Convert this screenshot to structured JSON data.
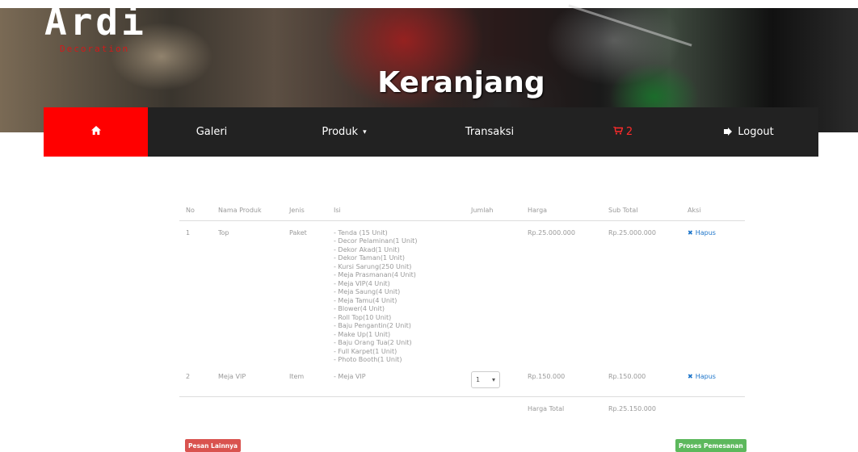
{
  "brand": {
    "logo": "Ardi",
    "logo_sub": "Decoration"
  },
  "header": {
    "title": "Keranjang"
  },
  "nav": {
    "home_icon": "home-icon",
    "galeri": "Galeri",
    "produk": "Produk",
    "produk_caret": "▾",
    "transaksi": "Transaksi",
    "cart_icon": "cart-icon",
    "cart_count": "2",
    "logout_icon": "sign-out-icon",
    "logout": "Logout"
  },
  "table": {
    "headers": [
      "No",
      "Nama Produk",
      "Jenis",
      "Isi",
      "Jumlah",
      "Harga",
      "Sub Total",
      "Aksi"
    ],
    "rows": [
      {
        "no": "1",
        "name": "Top",
        "jenis": "Paket",
        "isi": [
          "- Tenda (15 Unit)",
          "- Decor Pelaminan(1 Unit)",
          "- Dekor Akad(1 Unit)",
          "- Dekor Taman(1 Unit)",
          "- Kursi Sarung(250 Unit)",
          "- Meja Prasmanan(4 Unit)",
          "- Meja VIP(4 Unit)",
          "- Meja Saung(4 Unit)",
          "- Meja Tamu(4 Unit)",
          "- Blower(4 Unit)",
          "- Roll Top(10 Unit)",
          "- Baju Pengantin(2 Unit)",
          "- Make Up(1 Unit)",
          "- Baju Orang Tua(2 Unit)",
          "- Full Karpet(1 Unit)",
          "- Photo Booth(1 Unit)"
        ],
        "jumlah": "",
        "harga": "Rp.25.000.000",
        "subtotal": "Rp.25.000.000",
        "aksi": "Hapus"
      },
      {
        "no": "2",
        "name": "Meja VIP",
        "jenis": "Item",
        "isi": [
          "- Meja VIP"
        ],
        "jumlah": "1",
        "harga": "Rp.150.000",
        "subtotal": "Rp.150.000",
        "aksi": "Hapus"
      }
    ],
    "total_label": "Harga Total",
    "total_value": "Rp.25.150.000"
  },
  "buttons": {
    "pesan": "Pesan Lainnya",
    "proses": "Proses Pemesanan"
  },
  "colors": {
    "nav_bg": "#222222",
    "home_active": "#ff0000",
    "cart": "#ff2b2b",
    "link": "#1a73c9",
    "btn_red": "#d9534f",
    "btn_green": "#5cb85c"
  }
}
